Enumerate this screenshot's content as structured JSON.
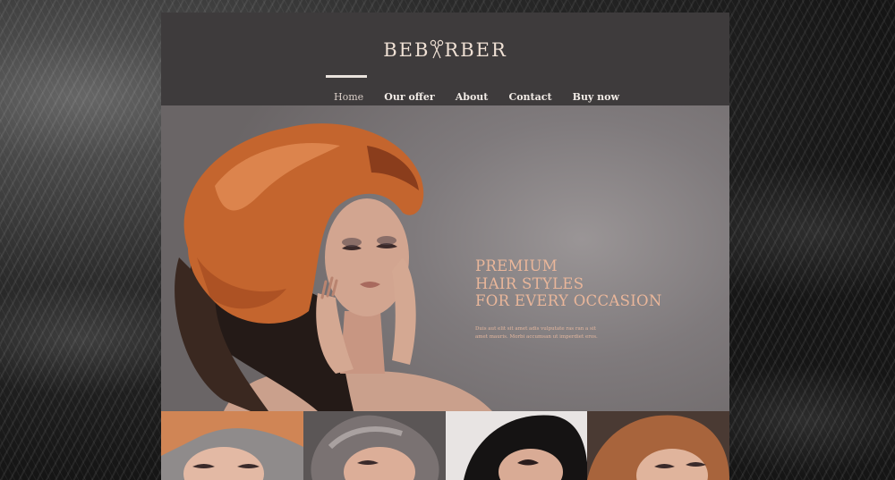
{
  "brand": {
    "logo_text_left": "BEB",
    "logo_text_right": "RBER"
  },
  "nav": {
    "items": [
      {
        "label": "Home"
      },
      {
        "label": "Our offer"
      },
      {
        "label": "About"
      },
      {
        "label": "Contact"
      },
      {
        "label": "Buy now"
      }
    ]
  },
  "hero": {
    "headline": [
      "PREMIUM",
      "HAIR STYLES",
      "FOR EVERY OCCASION"
    ],
    "subtext": "Duis aut elit sit amet adis vulputate ras ran a sit amet mauris. Morbi accumsan ut imperdiet eros."
  },
  "colors": {
    "accent_text": "#e9b69a",
    "header_bg": "#3e3b3c",
    "hair_copper": "#c4652e"
  }
}
